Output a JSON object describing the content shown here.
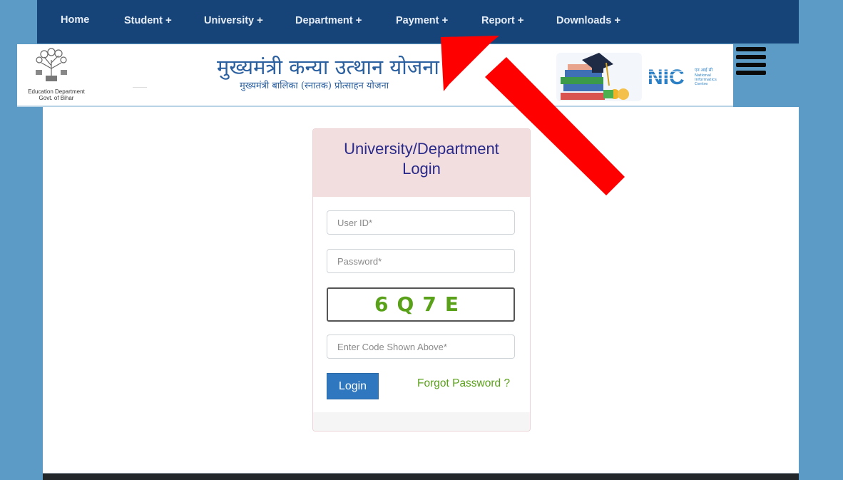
{
  "nav": {
    "items": [
      {
        "label": "Home",
        "has_submenu": false
      },
      {
        "label": "Student",
        "has_submenu": true
      },
      {
        "label": "University",
        "has_submenu": true
      },
      {
        "label": "Department",
        "has_submenu": true
      },
      {
        "label": "Payment",
        "has_submenu": true
      },
      {
        "label": "Report",
        "has_submenu": true
      },
      {
        "label": "Downloads",
        "has_submenu": true
      }
    ],
    "submenu_symbol": "+"
  },
  "banner": {
    "emblem_caption_line1": "Education Department",
    "emblem_caption_line2": "Govt. of Bihar",
    "title": "मुख्यमंत्री कन्या उत्थान योजना",
    "subtitle": "मुख्यमंत्री बालिका (स्नातक) प्रोत्साहन योजना",
    "nic_logo_text": "NIC",
    "nic_caption_hindi": "एन आई सी",
    "nic_caption_en": [
      "National",
      "Informatics",
      "Centre"
    ]
  },
  "login": {
    "title_line1": "University/Department",
    "title_line2": "Login",
    "user_id_placeholder": "User ID*",
    "password_placeholder": "Password*",
    "captcha_code": "6Q7E",
    "captcha_input_placeholder": "Enter Code Shown Above*",
    "login_button": "Login",
    "forgot_password_link": "Forgot Password ?"
  },
  "colors": {
    "page_bg": "#5b9bc6",
    "nav_bg": "#164479",
    "card_header_bg": "#f2dede",
    "card_title": "#2a2a8a",
    "captcha_text": "#5aa11a",
    "login_button": "#2f77be",
    "forgot_link": "#5aa11a",
    "annotation_arrow": "#ff0000"
  },
  "annotation": {
    "type": "arrow",
    "points_to": "Payment menu"
  }
}
